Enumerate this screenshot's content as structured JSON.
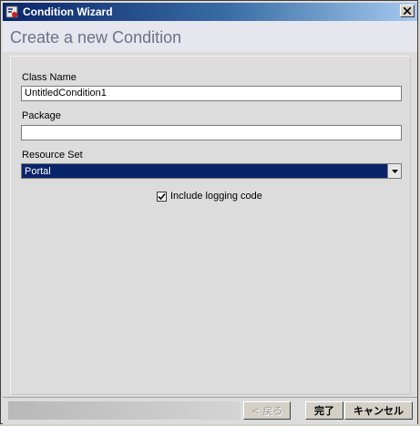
{
  "window": {
    "title": "Condition Wizard"
  },
  "header": {
    "page_title": "Create a new Condition"
  },
  "form": {
    "class_name_label": "Class Name",
    "class_name_value": "UntitledCondition1",
    "package_label": "Package",
    "package_value": "",
    "resource_set_label": "Resource Set",
    "resource_set_value": "Portal",
    "logging_checkbox_label": "Include logging code",
    "logging_checked": true
  },
  "buttons": {
    "back": "< 戻る",
    "finish": "完了",
    "cancel": "キャンセル"
  }
}
